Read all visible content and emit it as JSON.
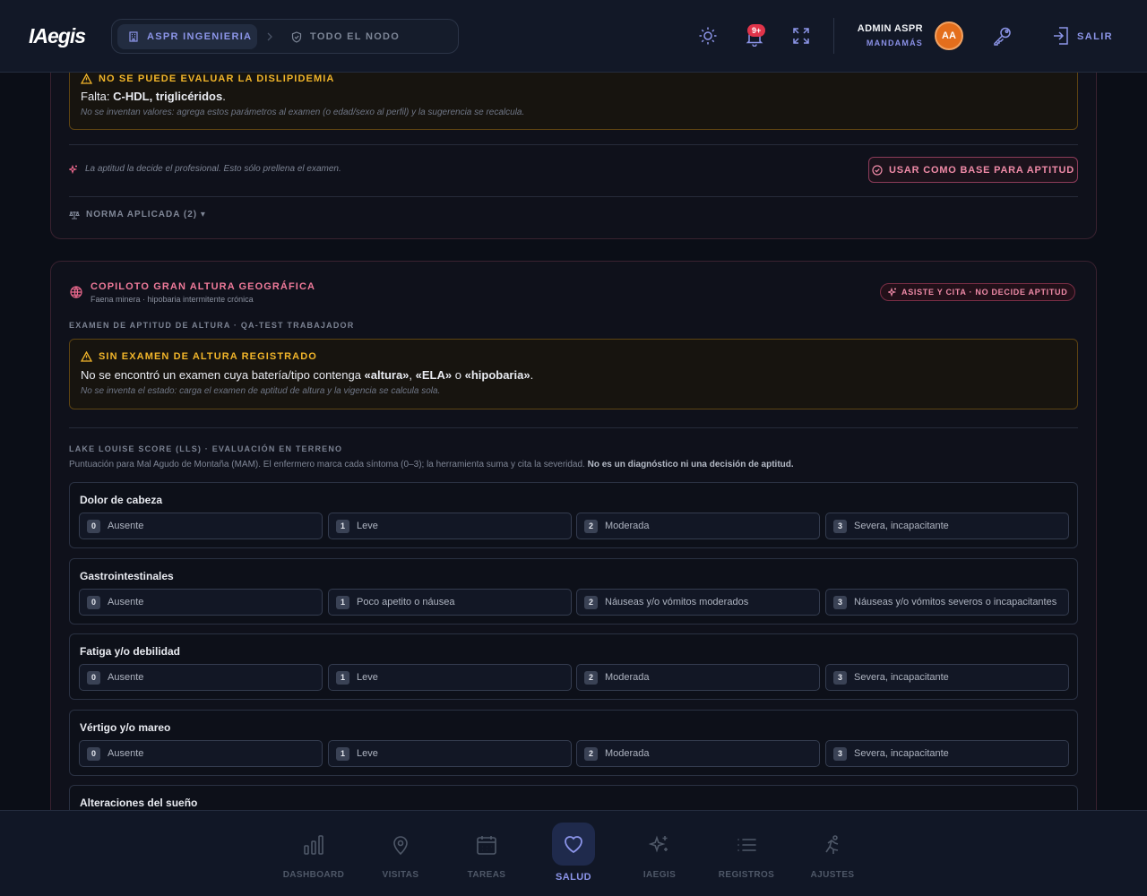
{
  "header": {
    "logo": "IAegis",
    "breadcrumb": {
      "company": "ASPR INGENIERIA",
      "scope": "TODO EL NODO"
    },
    "notifications_badge": "9+",
    "user": {
      "name": "ADMIN ASPR",
      "role": "MANDAMÁS",
      "initials": "AA"
    },
    "logout_label": "SALIR"
  },
  "dyslipidemia": {
    "warning_title": "NO SE PUEDE EVALUAR LA DISLIPIDEMIA",
    "missing_label": "Falta:",
    "missing_values": "C-HDL, triglicéridos",
    "missing_end": ".",
    "note": "No se inventan valores: agrega estos parámetros al examen (o edad/sexo al perfil) y la sugerencia se recalcula.",
    "aptitude_note": "La aptitud la decide el profesional. Esto sólo prellena el examen.",
    "use_button": "USAR COMO BASE PARA APTITUD",
    "norma_label": "NORMA APLICADA (2) ▾"
  },
  "altitude": {
    "title": "COPILOTO GRAN ALTURA GEOGRÁFICA",
    "subtitle": "Faena minera · hipobaria intermitente crónica",
    "badge": "ASISTE Y CITA · NO DECIDE APTITUD",
    "exam_section": "EXAMEN DE APTITUD DE ALTURA · QA-TEST TRABAJADOR",
    "warning_title": "SIN EXAMEN DE ALTURA REGISTRADO",
    "warning_text_1": "No se encontró un examen cuya batería/tipo contenga ",
    "kw_1": "«altura»",
    "sep_1": ", ",
    "kw_2": "«ELA»",
    "sep_2": " o ",
    "kw_3": "«hipobaria»",
    "end": ".",
    "warning_note": "No se inventa el estado: carga el examen de aptitud de altura y la vigencia se calcula sola.",
    "lls_section": "LAKE LOUISE SCORE (LLS) · EVALUACIÓN EN TERRENO",
    "lls_desc": "Puntuación para Mal Agudo de Montaña (MAM). El enfermero marca cada síntoma (0–3); la herramienta suma y cita la severidad.",
    "lls_desc_bold": "No es un diagnóstico ni una decisión de aptitud.",
    "symptoms": [
      {
        "name": "Dolor de cabeza",
        "options": [
          {
            "score": "0",
            "label": "Ausente"
          },
          {
            "score": "1",
            "label": "Leve"
          },
          {
            "score": "2",
            "label": "Moderada"
          },
          {
            "score": "3",
            "label": "Severa, incapacitante"
          }
        ]
      },
      {
        "name": "Gastrointestinales",
        "options": [
          {
            "score": "0",
            "label": "Ausente"
          },
          {
            "score": "1",
            "label": "Poco apetito o náusea"
          },
          {
            "score": "2",
            "label": "Náuseas y/o vómitos moderados"
          },
          {
            "score": "3",
            "label": "Náuseas y/o vómitos severos o incapacitantes"
          }
        ]
      },
      {
        "name": "Fatiga y/o debilidad",
        "options": [
          {
            "score": "0",
            "label": "Ausente"
          },
          {
            "score": "1",
            "label": "Leve"
          },
          {
            "score": "2",
            "label": "Moderada"
          },
          {
            "score": "3",
            "label": "Severa, incapacitante"
          }
        ]
      },
      {
        "name": "Vértigo y/o mareo",
        "options": [
          {
            "score": "0",
            "label": "Ausente"
          },
          {
            "score": "1",
            "label": "Leve"
          },
          {
            "score": "2",
            "label": "Moderada"
          },
          {
            "score": "3",
            "label": "Severa, incapacitante"
          }
        ]
      },
      {
        "name": "Alteraciones del sueño",
        "options": []
      }
    ]
  },
  "bottom_nav": [
    {
      "label": "DASHBOARD",
      "icon": "bar-chart-icon"
    },
    {
      "label": "VISITAS",
      "icon": "map-pin-icon"
    },
    {
      "label": "TAREAS",
      "icon": "calendar-icon"
    },
    {
      "label": "SALUD",
      "icon": "heart-icon"
    },
    {
      "label": "IAEGIS",
      "icon": "sparkles-icon"
    },
    {
      "label": "REGISTROS",
      "icon": "list-icon"
    },
    {
      "label": "AJUSTES",
      "icon": "running-person-icon"
    }
  ],
  "colors": {
    "accent": "#8c95e8",
    "warning": "#f1b52a",
    "pink": "#ef8aa7",
    "avatar": "#e46e1c"
  }
}
